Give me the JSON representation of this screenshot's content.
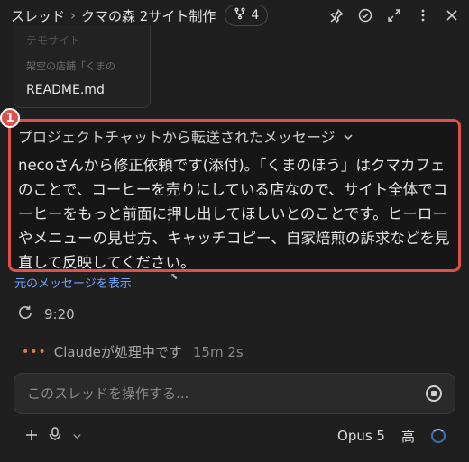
{
  "header": {
    "crumb_threads": "スレッド",
    "crumb_separator": "›",
    "thread_title": "クマの森 2サイト制作",
    "branch_count": "4"
  },
  "file_card": {
    "title": "テモサイト",
    "subtitle": "架空の店舗「くまの",
    "name": "README.md"
  },
  "annotation": {
    "number": "1"
  },
  "forwarded": {
    "title": "プロジェクトチャットから転送されたメッセージ",
    "body": "necoさんから修正依頼です(添付)。「くまのほう」はクマカフェのことで、コーヒーを売りにしている店なので、サイト全体でコーヒーをもっと前面に押し出してほしいとのことです。ヒーローやメニューの見せ方、キャッチコピー、自家焙煎の訴求などを見直して反映してください。",
    "show_original": "元のメッセージを表示"
  },
  "time": "9:20",
  "status": {
    "text": "Claudeが処理中です",
    "elapsed": "15m 2s"
  },
  "composer": {
    "placeholder": "このスレッドを操作する..."
  },
  "bottom": {
    "model": "Opus 5",
    "effort": "高"
  },
  "colors": {
    "highlight": "#e0504a",
    "link": "#6fa3ff",
    "accent": "#e07b4c"
  }
}
